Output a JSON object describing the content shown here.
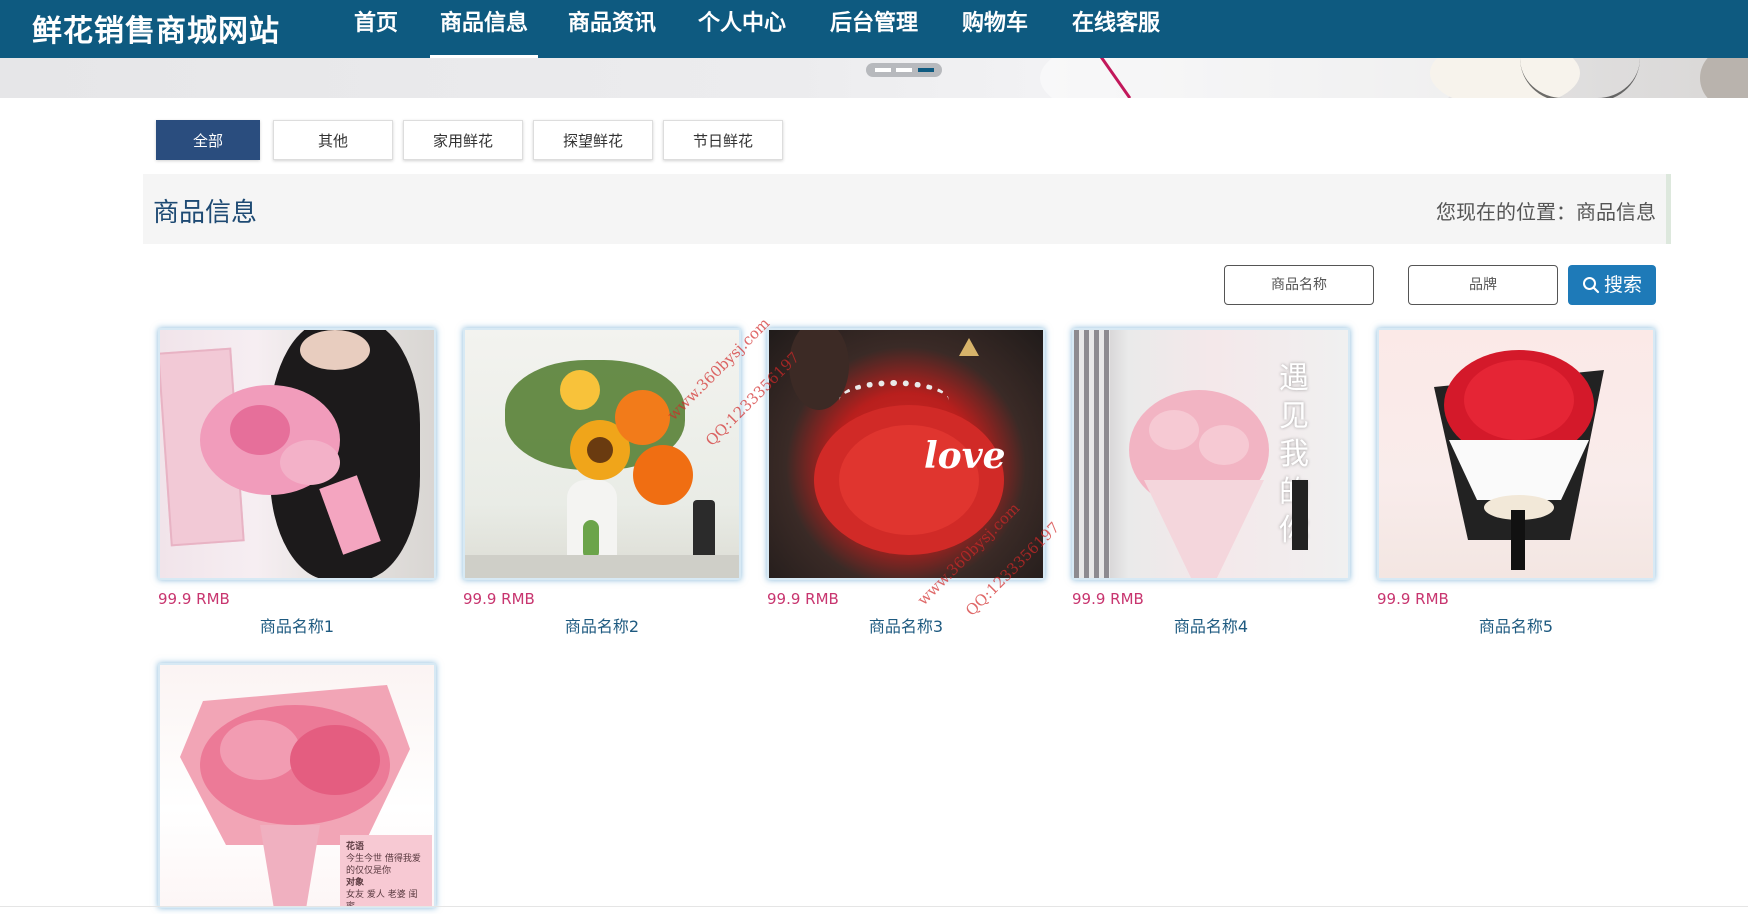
{
  "site": {
    "title": "鲜花销售商城网站"
  },
  "nav": [
    {
      "label": "首页"
    },
    {
      "label": "商品信息",
      "active": true
    },
    {
      "label": "商品资讯"
    },
    {
      "label": "个人中心"
    },
    {
      "label": "后台管理"
    },
    {
      "label": "购物车"
    },
    {
      "label": "在线客服"
    }
  ],
  "banner": {
    "slides": 3,
    "active_slide": 3
  },
  "categories": [
    {
      "label": "全部",
      "active": true
    },
    {
      "label": "其他"
    },
    {
      "label": "家用鲜花"
    },
    {
      "label": "探望鲜花"
    },
    {
      "label": "节日鲜花"
    }
  ],
  "panel": {
    "title": "商品信息",
    "breadcrumb": "您现在的位置：商品信息"
  },
  "search": {
    "name_placeholder": "商品名称",
    "brand_placeholder": "品牌",
    "button_label": "搜索",
    "icon": "search-icon"
  },
  "products": [
    {
      "price": "99.9 RMB",
      "name": "商品名称1"
    },
    {
      "price": "99.9 RMB",
      "name": "商品名称2"
    },
    {
      "price": "99.9 RMB",
      "name": "商品名称3"
    },
    {
      "price": "99.9 RMB",
      "name": "商品名称4"
    },
    {
      "price": "99.9 RMB",
      "name": "商品名称5"
    },
    {
      "price": "",
      "name": ""
    }
  ],
  "image_texts": {
    "love": "love",
    "poem_big": "遇见我的你",
    "card_1_title": "花语",
    "card_1_line": "今生今世 借得我爱的仅仅是你",
    "card_2_title": "对象",
    "card_2_line": "女友 爱人 老婆 闺蜜"
  },
  "watermarks": [
    "www.360bysj.com",
    "QQ:1233356197"
  ],
  "colors": {
    "nav_bg": "#0e5a80",
    "category_active": "#2a4d7e",
    "search_button": "#1e7ab8",
    "price": "#c8356f",
    "product_name": "#1e5a80"
  }
}
